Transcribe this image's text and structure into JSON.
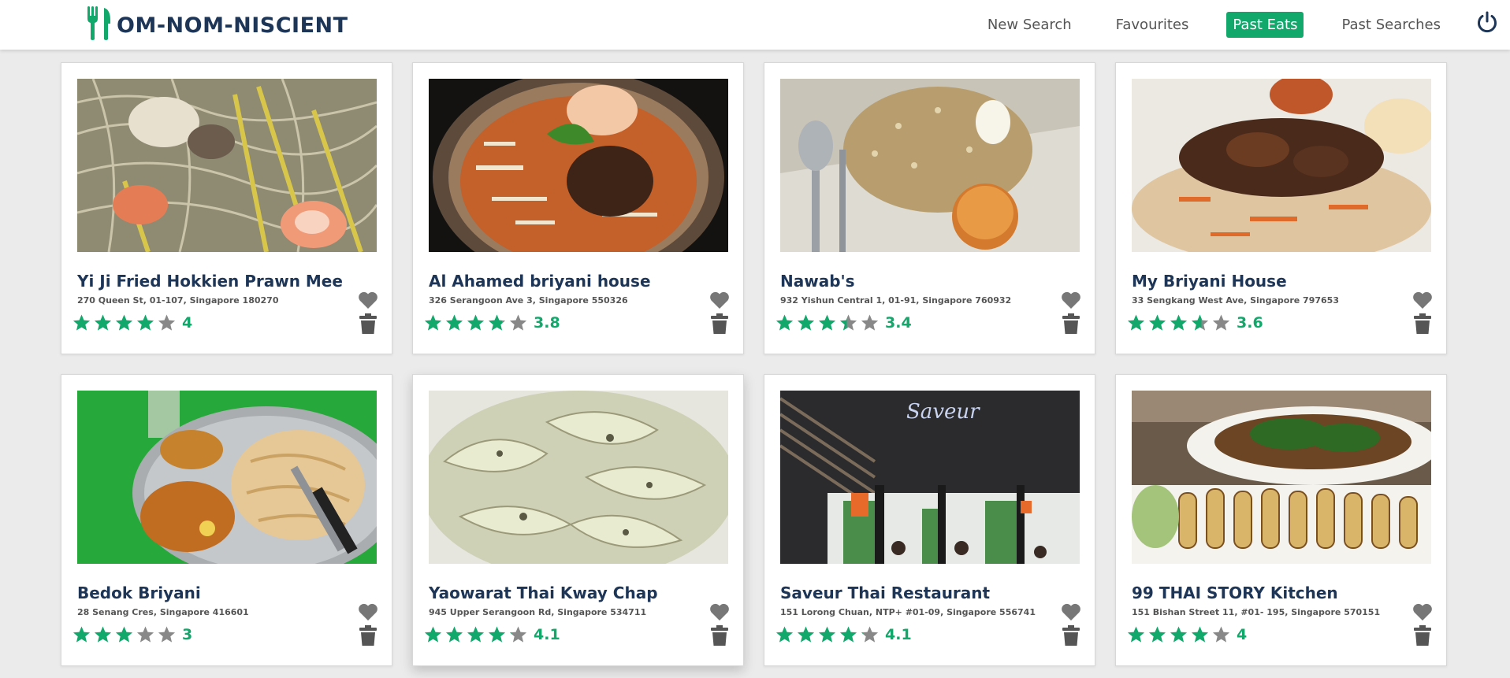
{
  "app": {
    "logo_text": "OM-NOM-NISCIENT"
  },
  "nav": {
    "links": [
      {
        "label": "New Search",
        "active": false
      },
      {
        "label": "Favourites",
        "active": false
      },
      {
        "label": "Past Eats",
        "active": true
      },
      {
        "label": "Past Searches",
        "active": false
      }
    ],
    "logout_icon": "power-icon"
  },
  "colors": {
    "brand_green": "#12a86b",
    "navy": "#1d3557",
    "star_empty": "#888888",
    "icon_gray": "#777777"
  },
  "restaurants": [
    {
      "name": "Yi Ji Fried Hokkien Prawn Mee",
      "address": "270 Queen St, 01-107, Singapore 180270",
      "rating": "4",
      "rating_value": 4,
      "photo": "hokkien-mee-photo"
    },
    {
      "name": "Al Ahamed briyani house",
      "address": "326 Serangoon Ave 3, Singapore 550326",
      "rating": "3.8",
      "rating_value": 3.8,
      "photo": "biryani-bowl-photo"
    },
    {
      "name": "Nawab's",
      "address": "932 Yishun Central 1, 01-91, Singapore 760932",
      "rating": "3.4",
      "rating_value": 3.4,
      "photo": "biryani-plate-photo"
    },
    {
      "name": "My Briyani House",
      "address": "33 Sengkang West Ave, Singapore 797653",
      "rating": "3.6",
      "rating_value": 3.6,
      "photo": "mutton-biryani-photo"
    },
    {
      "name": "Bedok Briyani",
      "address": "28 Senang Cres, Singapore 416601",
      "rating": "3",
      "rating_value": 3,
      "photo": "prata-curry-photo"
    },
    {
      "name": "Yaowarat Thai Kway Chap",
      "address": "945 Upper Serangoon Rd, Singapore 534711",
      "rating": "4.1",
      "rating_value": 4.1,
      "photo": "fried-cabbage-photo"
    },
    {
      "name": "Saveur Thai Restaurant",
      "address": "151 Lorong Chuan, NTP+ #01-09, Singapore 556741",
      "rating": "4.1",
      "rating_value": 4.1,
      "photo": "restaurant-interior-photo"
    },
    {
      "name": "99 THAI STORY Kitchen",
      "address": "151 Bishan Street 11, #01- 195, Singapore 570151",
      "rating": "4",
      "rating_value": 4,
      "photo": "squid-kangkong-photo"
    }
  ]
}
